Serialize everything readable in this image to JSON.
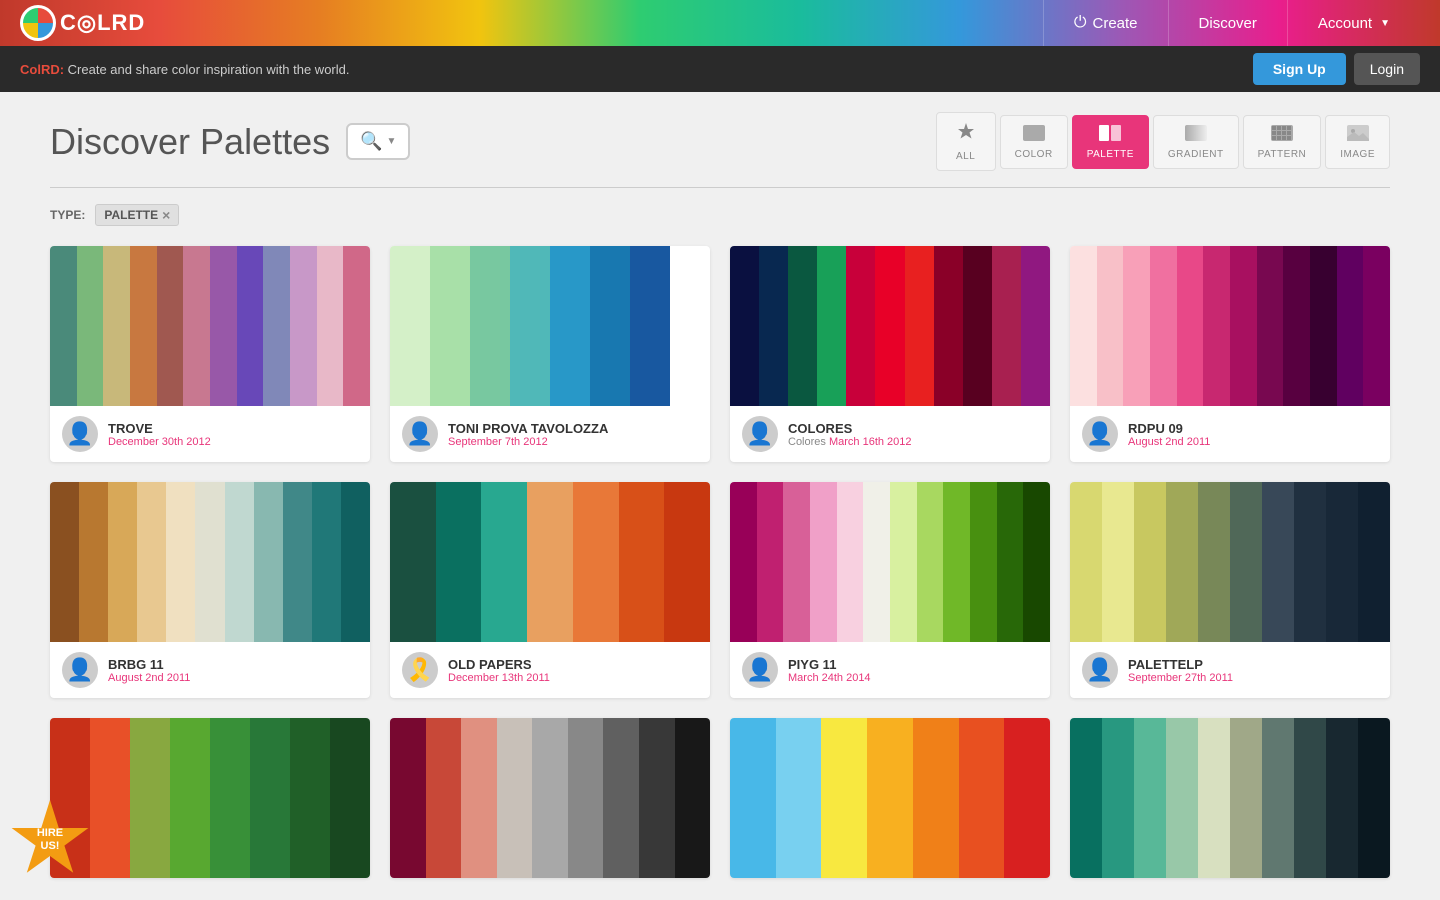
{
  "header": {
    "logo_text": "C◎LRD",
    "nav": {
      "create_label": "Create",
      "discover_label": "Discover",
      "account_label": "Account"
    }
  },
  "announce": {
    "text_bold": "ColRD:",
    "text_rest": " Create and share color inspiration with the world.",
    "signup_label": "Sign Up",
    "login_label": "Login"
  },
  "page": {
    "title": "Discover Palettes",
    "search_placeholder": "Search"
  },
  "filters": {
    "tabs": [
      {
        "id": "all",
        "label": "ALL",
        "icon": "✳"
      },
      {
        "id": "color",
        "label": "COLOR",
        "icon": "⬛"
      },
      {
        "id": "palette",
        "label": "PALETTE",
        "icon": "▮▮"
      },
      {
        "id": "gradient",
        "label": "GRADIENT",
        "icon": "⬜"
      },
      {
        "id": "pattern",
        "label": "PATTERN",
        "icon": "⣿"
      },
      {
        "id": "image",
        "label": "IMAGE",
        "icon": "🖼"
      }
    ],
    "active": "palette",
    "type_label": "TYPE:",
    "type_value": "PALETTE",
    "type_close": "×"
  },
  "palettes": [
    {
      "id": "trove",
      "name": "TROVE",
      "date": "December 30th 2012",
      "subtitle": "",
      "subtitle_date": "",
      "avatar_type": "person",
      "colors": [
        "#4a8a7a",
        "#7ab87a",
        "#c8b87a",
        "#c87840",
        "#a05850",
        "#c87890",
        "#9858a8",
        "#6848b8",
        "#8088b8",
        "#c898c8",
        "#e8b8c8",
        "#d06888"
      ]
    },
    {
      "id": "toni-prova",
      "name": "TONI PROVA TAVOLOZZA",
      "date": "September 7th 2012",
      "subtitle": "",
      "subtitle_date": "",
      "avatar_type": "person",
      "colors": [
        "#d4f0c8",
        "#a8e0a8",
        "#78c8a0",
        "#50b8b8",
        "#2898c8",
        "#1878b0",
        "#1858a0",
        "#1040888"
      ]
    },
    {
      "id": "colores",
      "name": "COLORES",
      "date": "March 16th 2012",
      "subtitle": "Colores ",
      "subtitle_date": "March 16th 2012",
      "avatar_type": "person",
      "colors": [
        "#0a1040",
        "#082850",
        "#0a5840",
        "#18a058",
        "#c8003a",
        "#e80028",
        "#e82020",
        "#8a0028",
        "#580020",
        "#a82050",
        "#901880"
      ]
    },
    {
      "id": "rdpu09",
      "name": "RDPU 09",
      "date": "August 2nd 2011",
      "subtitle": "",
      "subtitle_date": "",
      "avatar_type": "person",
      "colors": [
        "#fce0e0",
        "#f8c0c8",
        "#f8a0b8",
        "#f070a0",
        "#e84888",
        "#c82870",
        "#a81060",
        "#780850",
        "#580040",
        "#380030",
        "#600060",
        "#7a0060"
      ]
    },
    {
      "id": "brbg11",
      "name": "BRBG 11",
      "date": "August 2nd 2011",
      "subtitle": "",
      "subtitle_date": "",
      "avatar_type": "person",
      "colors": [
        "#8a5020",
        "#b87830",
        "#d8a858",
        "#e8c890",
        "#f0e0c0",
        "#e0e0d0",
        "#c0d8d0",
        "#88b8b0",
        "#408888",
        "#207878",
        "#106060"
      ]
    },
    {
      "id": "old-papers",
      "name": "OLD PAPERS",
      "date": "December 13th 2011",
      "subtitle": "",
      "subtitle_date": "",
      "avatar_type": "ribbon",
      "colors": [
        "#1a5040",
        "#0a7060",
        "#28a890",
        "#e8a060",
        "#e87838",
        "#d85018",
        "#c83810"
      ]
    },
    {
      "id": "piyg11",
      "name": "PIYG 11",
      "date": "March 24th 2014",
      "subtitle": "",
      "subtitle_date": "",
      "avatar_type": "person",
      "colors": [
        "#980058",
        "#c02070",
        "#d86098",
        "#f0a0c8",
        "#f8d0e0",
        "#f0f0e8",
        "#d8f0a0",
        "#a8d860",
        "#70b828",
        "#489010",
        "#286808",
        "#184800"
      ]
    },
    {
      "id": "palettelp",
      "name": "PALETTELP",
      "date": "September 27th 2011",
      "subtitle": "",
      "subtitle_date": "",
      "avatar_type": "person",
      "colors": [
        "#d8d870",
        "#e8e890",
        "#c8c860",
        "#a0a858",
        "#788858",
        "#506858",
        "#384858",
        "#203040",
        "#182838",
        "#102030"
      ]
    },
    {
      "id": "row3-1",
      "name": "",
      "date": "",
      "subtitle": "",
      "subtitle_date": "",
      "avatar_type": "person",
      "colors": [
        "#c83018",
        "#e85028",
        "#88a840",
        "#58a830",
        "#389038",
        "#287838",
        "#206028",
        "#184820"
      ]
    },
    {
      "id": "row3-2",
      "name": "",
      "date": "",
      "subtitle": "",
      "subtitle_date": "",
      "avatar_type": "person",
      "colors": [
        "#780830",
        "#c84838",
        "#e09080",
        "#c8c0b8",
        "#a8a8a8",
        "#888888",
        "#606060",
        "#383838",
        "#181818"
      ]
    },
    {
      "id": "row3-3",
      "name": "",
      "date": "",
      "subtitle": "",
      "subtitle_date": "",
      "avatar_type": "person",
      "colors": [
        "#48b8e8",
        "#78d0f0",
        "#f8e840",
        "#f8b020",
        "#f08018",
        "#e85020",
        "#d82020"
      ]
    },
    {
      "id": "row3-4",
      "name": "",
      "date": "",
      "subtitle": "",
      "subtitle_date": "",
      "avatar_type": "person",
      "colors": [
        "#087060",
        "#289880",
        "#58b898",
        "#98c8a8",
        "#d8e0c0",
        "#a0a888",
        "#607870",
        "#304848",
        "#182830",
        "#0a1820"
      ]
    }
  ],
  "hire_us": {
    "line1": "HIRE",
    "line2": "US!"
  }
}
